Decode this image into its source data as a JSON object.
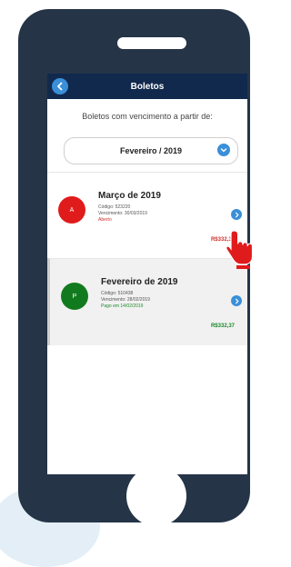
{
  "header": {
    "title": "Boletos"
  },
  "filter": {
    "intro_label": "Boletos com vencimento a partir de:",
    "selected_period": "Fevereiro / 2019"
  },
  "boletos": [
    {
      "title": "Março de 2019",
      "code": "Código: 523220",
      "due": "Vencimento: 30/03/2019",
      "status": "Aberto",
      "amount": "R$332,37",
      "circle_color": "#e01b1b",
      "status_color": "#d0312d",
      "circle_letter": "A"
    },
    {
      "title": "Fevereiro de 2019",
      "code": "Código: 510438",
      "due": "Vencimento: 28/02/2019",
      "status": "Pago em 14/02/2019",
      "amount": "R$332,37",
      "circle_color": "#127a1e",
      "status_color": "#1b8a2a",
      "circle_letter": "P"
    }
  ],
  "colors": {
    "phone_body": "#253447",
    "header_bg": "#11294d",
    "accent": "#3a8fd8"
  }
}
